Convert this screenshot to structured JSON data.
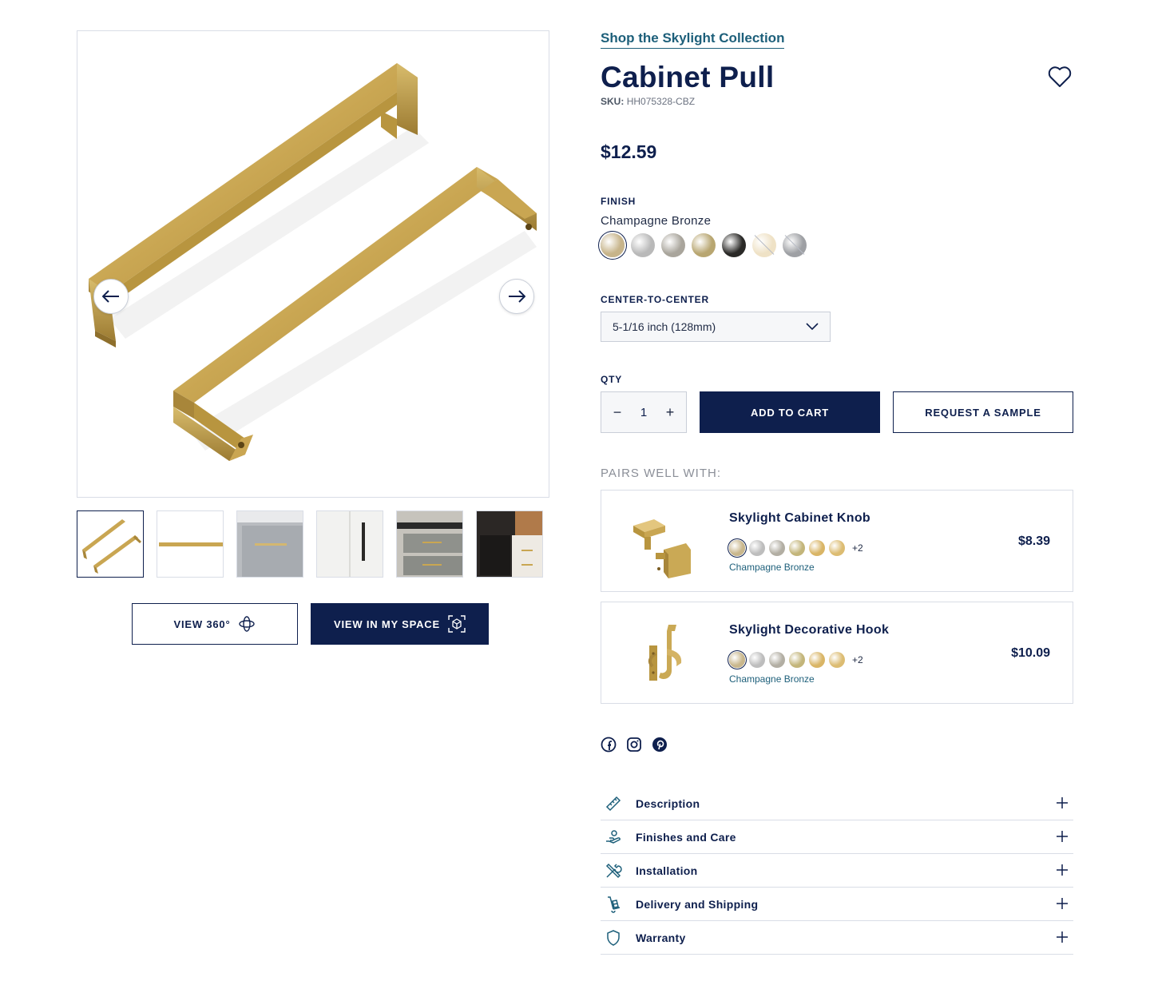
{
  "gallery": {
    "view360_label": "VIEW 360°",
    "view_in_space_label": "VIEW IN MY SPACE"
  },
  "product": {
    "collection_link": "Shop the Skylight Collection",
    "title": "Cabinet Pull",
    "sku_label": "SKU:",
    "sku": "HH075328-CBZ",
    "price": "$12.59",
    "finish_label": "FINISH",
    "finish_selected": "Champagne Bronze",
    "finish_swatches": [
      {
        "color": "#c7b48a",
        "selected": true
      },
      {
        "color": "#b9b9b9",
        "selected": false
      },
      {
        "color": "#a9a59c",
        "selected": false
      },
      {
        "color": "#b8a671",
        "selected": false
      },
      {
        "color": "#2a2927",
        "selected": false
      },
      {
        "color": "#efe2c6",
        "selected": false
      },
      {
        "color": "#9ea0a4",
        "selected": false
      }
    ],
    "ctc_label": "CENTER-TO-CENTER",
    "ctc_value": "5-1/16 inch (128mm)",
    "qty_label": "QTY",
    "qty_value": "1",
    "qty_minus": "−",
    "qty_plus": "+",
    "add_to_cart": "ADD TO CART",
    "request_sample": "REQUEST A SAMPLE"
  },
  "pairs": {
    "label": "PAIRS WELL WITH:",
    "items": [
      {
        "name": "Skylight Cabinet Knob",
        "price": "$8.39",
        "finish": "Champagne Bronze",
        "more": "+2"
      },
      {
        "name": "Skylight Decorative Hook",
        "price": "$10.09",
        "finish": "Champagne Bronze",
        "more": "+2"
      }
    ],
    "dot_colors": [
      "#c9b78c",
      "#bdbdbd",
      "#b2aea3",
      "#c3b57a",
      "#d9b566",
      "#dcbc72"
    ]
  },
  "social": {
    "icons": [
      "facebook-icon",
      "instagram-icon",
      "pinterest-icon"
    ]
  },
  "accordion": {
    "items": [
      {
        "label": "Description"
      },
      {
        "label": "Finishes and Care"
      },
      {
        "label": "Installation"
      },
      {
        "label": "Delivery and Shipping"
      },
      {
        "label": "Warranty"
      }
    ]
  },
  "colors": {
    "navy": "#0e1f4d",
    "teal_link": "#1d5f7a",
    "border": "#d9dde6",
    "gold": "#c9a95c"
  }
}
